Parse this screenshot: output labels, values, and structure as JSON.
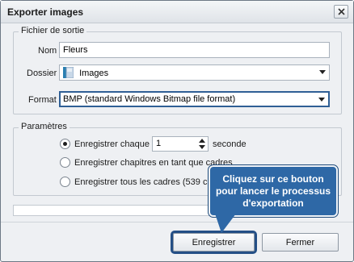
{
  "window": {
    "title": "Exporter images"
  },
  "output_group": {
    "legend": "Fichier de sortie",
    "name_label": "Nom",
    "name_value": "Fleurs",
    "folder_label": "Dossier",
    "folder_value": "Images",
    "format_label": "Format",
    "format_value": "BMP (standard Windows Bitmap file format)"
  },
  "params_group": {
    "legend": "Paramètres",
    "option1_label": "Enregistrer chaque",
    "option1_value": "1",
    "option1_suffix": "seconde",
    "option2_label": "Enregistrer chapitres en tant que cadres",
    "option3_label": "Enregistrer tous les cadres (539 cadres)"
  },
  "tooltip": {
    "text": "Cliquez sur ce bouton pour lancer le processus d'exportation"
  },
  "footer": {
    "save_label": "Enregistrer",
    "close_label": "Fermer"
  },
  "icons": {
    "close": "close-icon",
    "folder": "folder-icon",
    "dropdown": "chevron-down-icon"
  },
  "colors": {
    "tooltip_bg": "#2e68a6",
    "highlight_border": "#244f86"
  }
}
